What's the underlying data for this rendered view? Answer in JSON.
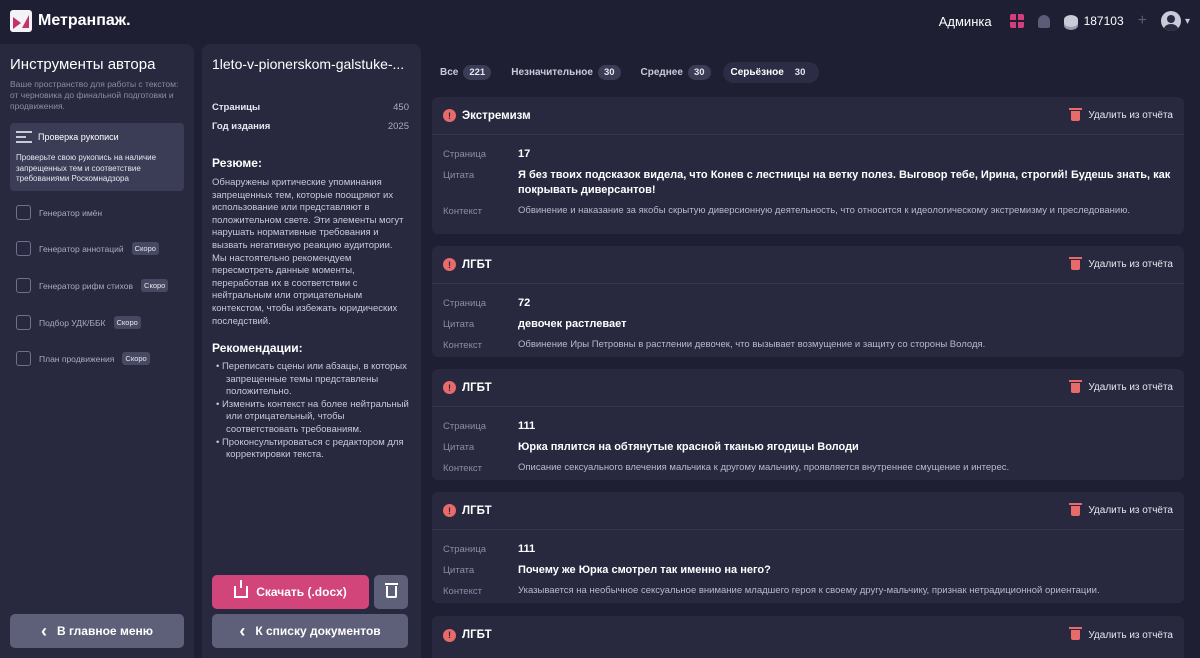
{
  "app": {
    "name": "Метранпаж."
  },
  "topbar": {
    "adminka": "Админка",
    "coins": "187103",
    "plus": "+",
    "chevron": "▾"
  },
  "sidebar": {
    "title": "Инструменты автора",
    "description": "Ваше пространство для работы с текстом: от черновика до финальной подготовки и продвижения.",
    "active_tool": {
      "label": "Проверка рукописи",
      "description": "Проверьте свою рукопись на наличие запрещенных тем и соответствие требованиями Роскомнадзора"
    },
    "items": [
      {
        "label": "Генератор имён",
        "badge": ""
      },
      {
        "label": "Генератор аннотаций",
        "badge": "Скоро"
      },
      {
        "label": "Генератор рифм стихов",
        "badge": "Скоро"
      },
      {
        "label": "Подбор УДК/ББК",
        "badge": "Скоро"
      },
      {
        "label": "План продвижения",
        "badge": "Скоро"
      }
    ],
    "main_menu_button": "В главное меню",
    "back_glyph": "‹"
  },
  "document": {
    "title": "1leto-v-pionerskom-galstuke-...",
    "pages_label": "Страницы",
    "pages_value": "450",
    "year_label": "Год издания",
    "year_value": "2025",
    "resume_heading": "Резюме:",
    "resume_text": "Обнаружены критические упоминания запрещенных тем, которые поощряют их использование или представляют в положительном свете. Эти элементы могут нарушать нормативные требования и вызвать негативную реакцию аудитории. Мы настоятельно рекомендуем пересмотреть данные моменты, переработав их в соответствии с нейтральным или отрицательным контекстом, чтобы избежать юридических последствий.",
    "recs_heading": "Рекомендации:",
    "recs": [
      "• Переписать сцены или абзацы, в которых запрещенные темы представлены положительно.",
      "• Изменить контекст на более нейтральный или отрицательный, чтобы соответствовать требованиям.",
      "• Проконсультироваться с редактором для корректировки текста."
    ],
    "download_button": "Скачать (.docx)",
    "list_button": "К списку документов"
  },
  "filters": [
    {
      "label": "Все",
      "count": "221"
    },
    {
      "label": "Незначительное",
      "count": "30"
    },
    {
      "label": "Среднее",
      "count": "30"
    },
    {
      "label": "Серьёзное",
      "count": "30"
    }
  ],
  "field_labels": {
    "page": "Страница",
    "quote": "Цитата",
    "context": "Контекст"
  },
  "remove_label": "Удалить из отчёта",
  "warn_glyph": "!",
  "cards": [
    {
      "category": "Экстремизм",
      "page": "17",
      "quote": "Я без твоих подсказок видела, что Конев с лестницы на ветку полез. Выговор тебе, Ирина, строгий! Будешь знать, как покрывать диверсантов!",
      "context": "Обвинение и наказание за якобы скрытую диверсионную деятельность, что относится к идеологическому экстремизму и преследованию."
    },
    {
      "category": "ЛГБТ",
      "page": "72",
      "quote": "девочек растлевает",
      "context": "Обвинение Иры Петровны в растлении девочек, что вызывает возмущение и защиту со стороны Володя."
    },
    {
      "category": "ЛГБТ",
      "page": "111",
      "quote": "Юрка пялится на обтянутые красной тканью ягодицы Володи",
      "context": "Описание сексуального влечения мальчика к другому мальчику, проявляется внутреннее смущение и интерес."
    },
    {
      "category": "ЛГБТ",
      "page": "111",
      "quote": "Почему же Юрка смотрел так именно на него?",
      "context": "Указывается на необычное сексуальное внимание младшего героя к своему другу-мальчику, признак нетрадиционной ориентации."
    },
    {
      "category": "ЛГБТ"
    }
  ]
}
